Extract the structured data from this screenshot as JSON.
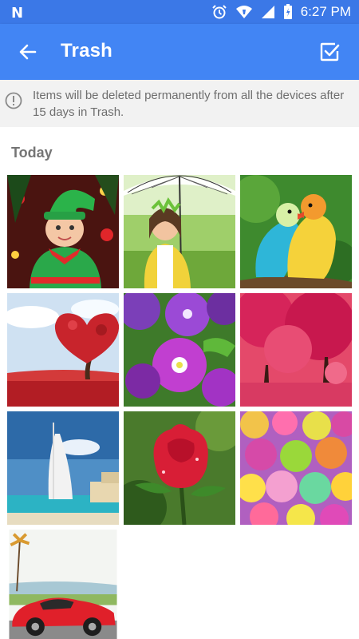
{
  "status_bar": {
    "time": "6:27 PM",
    "icons": [
      "n-logo-icon",
      "alarm-icon",
      "wifi-icon",
      "cell-signal-icon",
      "battery-icon"
    ],
    "logo": "N"
  },
  "app_bar": {
    "title": "Trash",
    "back_icon": "arrow-left-icon",
    "action_icon": "checkbox-select-icon",
    "color": "#4285f4"
  },
  "notice": {
    "icon": "info-icon",
    "text": "Items will be deleted permanently from all the devices after 15 days in Trash."
  },
  "section": {
    "title": "Today"
  },
  "photos": [
    {
      "subject": "baby in green elf costume"
    },
    {
      "subject": "girl with white umbrella"
    },
    {
      "subject": "two lovebird parrots"
    },
    {
      "subject": "heart-shaped red tree"
    },
    {
      "subject": "purple petunia flowers"
    },
    {
      "subject": "red blossom trees"
    },
    {
      "subject": "burj al arab beach"
    },
    {
      "subject": "red rose with droplets"
    },
    {
      "subject": "colorful chicks"
    },
    {
      "subject": "red sports car"
    }
  ]
}
